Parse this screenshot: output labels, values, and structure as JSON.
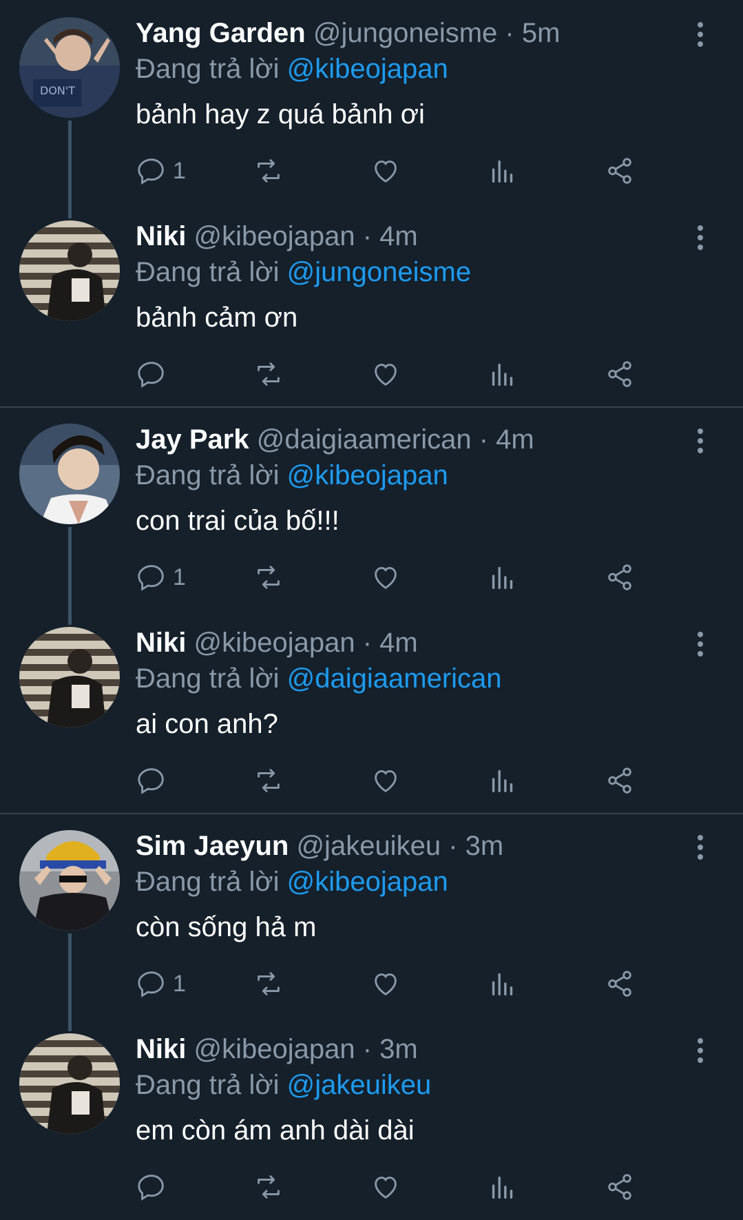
{
  "replies": [
    {
      "name": "Yang Garden",
      "handle": "@jungoneisme",
      "dot": "·",
      "time": "5m",
      "reply_prefix": "Đang trả lời",
      "reply_to": "@kibeojapan",
      "text": "bảnh hay z quá bảnh ơi",
      "reply_count": "1"
    },
    {
      "name": "Niki",
      "handle": "@kibeojapan",
      "dot": "·",
      "time": "4m",
      "reply_prefix": "Đang trả lời",
      "reply_to": "@jungoneisme",
      "text": "bảnh cảm ơn",
      "reply_count": ""
    },
    {
      "name": "Jay Park",
      "handle": "@daigiaamerican",
      "dot": "·",
      "time": "4m",
      "reply_prefix": "Đang trả lời",
      "reply_to": "@kibeojapan",
      "text": "con trai của bố!!!",
      "reply_count": "1"
    },
    {
      "name": "Niki",
      "handle": "@kibeojapan",
      "dot": "·",
      "time": "4m",
      "reply_prefix": "Đang trả lời",
      "reply_to": "@daigiaamerican",
      "text": "ai con anh?",
      "reply_count": ""
    },
    {
      "name": "Sim Jaeyun",
      "handle": "@jakeuikeu",
      "dot": "·",
      "time": "3m",
      "reply_prefix": "Đang trả lời",
      "reply_to": "@kibeojapan",
      "text": "còn sống hả m",
      "reply_count": "1"
    },
    {
      "name": "Niki",
      "handle": "@kibeojapan",
      "dot": "·",
      "time": "3m",
      "reply_prefix": "Đang trả lời",
      "reply_to": "@jakeuikeu",
      "text": "em còn ám anh dài dài",
      "reply_count": ""
    }
  ],
  "colors": {
    "background": "#15202b",
    "muted": "#8b98a5",
    "accent": "#1d9bf0",
    "divider": "#38444d"
  },
  "icons": [
    "reply-icon",
    "retweet-icon",
    "like-icon",
    "views-icon",
    "share-icon",
    "more-icon"
  ]
}
